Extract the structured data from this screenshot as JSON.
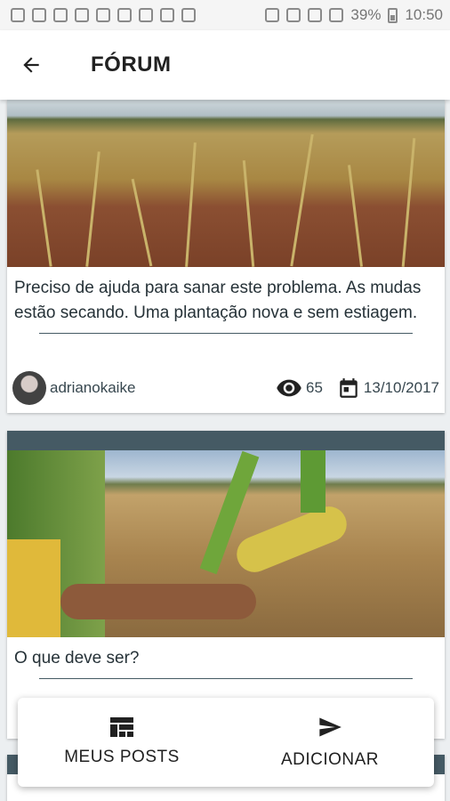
{
  "status_bar": {
    "battery_percent": "39%",
    "time": "10:50"
  },
  "app_bar": {
    "title": "FÓRUM"
  },
  "posts": [
    {
      "text": "Preciso de ajuda para sanar este problema. As mudas estão secando. Uma plantação nova e sem estiagem.",
      "author": "adrianokaike",
      "views": "65",
      "date": "13/10/2017"
    },
    {
      "text": "O que deve ser?"
    }
  ],
  "bottom_bar": {
    "my_posts_label": "MEUS POSTS",
    "add_label": "ADICIONAR"
  },
  "colors": {
    "header_strip": "#455a64",
    "text": "#263238"
  }
}
